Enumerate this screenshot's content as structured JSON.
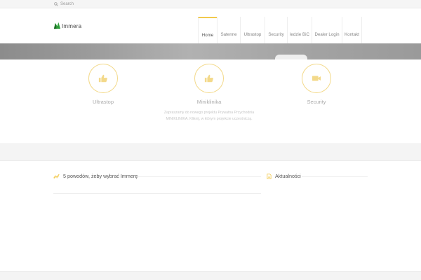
{
  "topbar": {
    "search_label": "Search",
    "search_icon": "search-icon"
  },
  "header": {
    "logo_text": "Immera",
    "logo_icon": "leaf-icon",
    "nav": [
      {
        "label": "Home",
        "active": true
      },
      {
        "label": "Satenne",
        "active": false
      },
      {
        "label": "Ultrastop",
        "active": false
      },
      {
        "label": "Security",
        "active": false
      },
      {
        "label": "ledzie BiC",
        "active": false
      },
      {
        "label": "Dealer Login",
        "active": false
      },
      {
        "label": "Kontakt",
        "active": false
      }
    ]
  },
  "features": [
    {
      "title": "Ultrastop",
      "icon": "thumbs-up-icon",
      "text": ""
    },
    {
      "title": "Miniklinika",
      "icon": "thumbs-up-icon",
      "text": "Zapraszamy do nowego projektu Prywatna Przychodnia MINIKLINIKA. Kliknij, w którym projekcie uczestniczą."
    },
    {
      "title": "Security",
      "icon": "video-camera-icon",
      "text": ""
    }
  ],
  "sections": {
    "reasons_title": "5 powodów, żeby wybrać Immerę",
    "reasons_icon": "trend-line-icon",
    "news_title": "Aktualności",
    "news_icon": "document-icon"
  },
  "colors": {
    "accent": "#f2c94c",
    "accent_light": "#f3d98a",
    "logo_green": "#2e9e3a"
  }
}
